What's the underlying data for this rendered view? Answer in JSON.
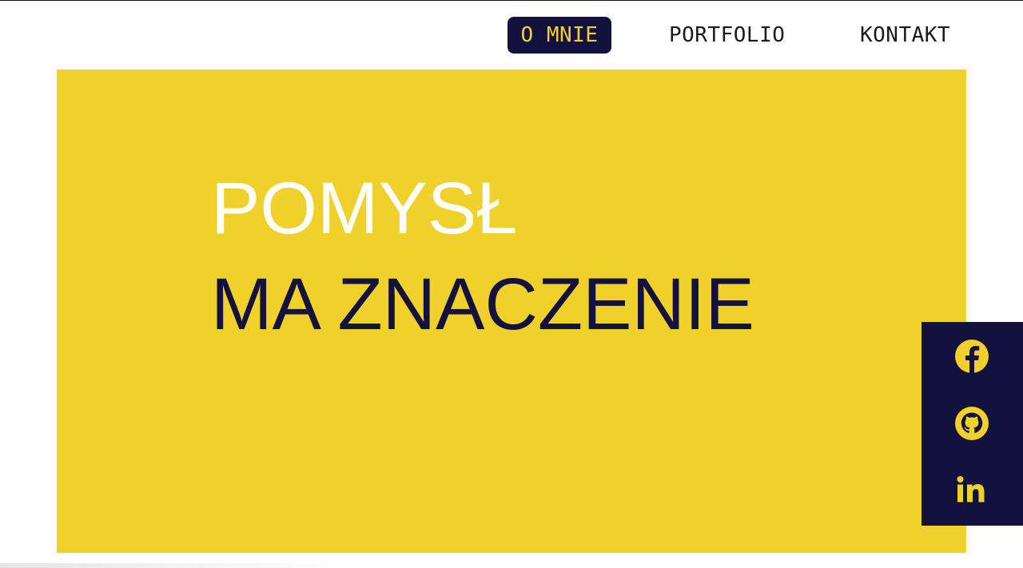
{
  "nav": {
    "items": [
      {
        "label": "O MNIE",
        "active": true
      },
      {
        "label": "PORTFOLIO",
        "active": false
      },
      {
        "label": "KONTAKT",
        "active": false
      }
    ]
  },
  "hero": {
    "line1": "POMYSŁ",
    "line2": "MA ZNACZENIE"
  },
  "social": {
    "icons": [
      "facebook-icon",
      "github-icon",
      "linkedin-icon"
    ]
  },
  "colors": {
    "accent_yellow": "#f0d12b",
    "navy": "#13123f",
    "white": "#ffffff"
  }
}
